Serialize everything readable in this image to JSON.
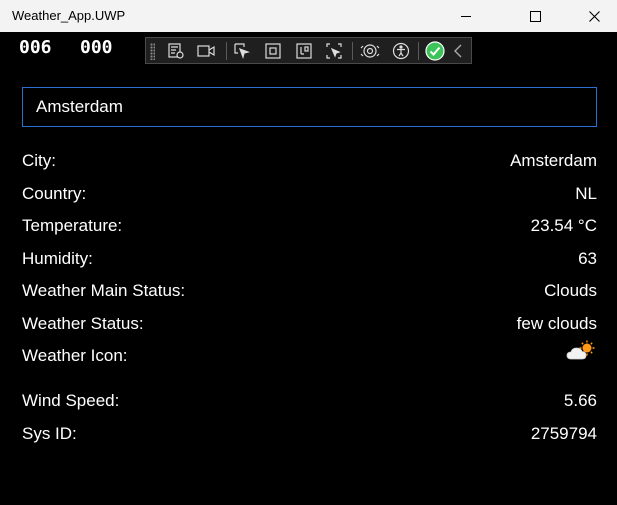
{
  "window": {
    "title": "Weather_App.UWP",
    "buttons": [
      "minimize-icon",
      "maximize-icon",
      "close-icon"
    ]
  },
  "frame_counters": [
    "006",
    "000"
  ],
  "debug_toolbar": {
    "icons": [
      "live-visual-tree-icon",
      "video-camera-icon",
      "select-element-icon",
      "display-layout-adorners-icon",
      "track-focus-icon",
      "show-binding-failures-icon",
      "hot-reload-icon",
      "accessibility-icon",
      "check-status-icon",
      "collapse-chevron-icon"
    ],
    "accent_check": "#3cc35a"
  },
  "search": {
    "value": "Amsterdam"
  },
  "rows": [
    {
      "label": "City:",
      "value": "Amsterdam"
    },
    {
      "label": "Country:",
      "value": "NL"
    },
    {
      "label": "Temperature:",
      "value": "23.54 °C"
    },
    {
      "label": "Humidity:",
      "value": "63"
    },
    {
      "label": "Weather Main Status:",
      "value": "Clouds"
    },
    {
      "label": "Weather Status:",
      "value": "few clouds"
    },
    {
      "label": "Weather Icon:",
      "icon": "few-clouds-day-icon"
    },
    {
      "label": "Wind Speed:",
      "value": "5.66"
    },
    {
      "label": "Sys ID:",
      "value": "2759794"
    }
  ],
  "colors": {
    "background": "#000000",
    "titlebar": "#f3f3f3",
    "input_border": "#2d6fd0",
    "text": "#ffffff"
  }
}
